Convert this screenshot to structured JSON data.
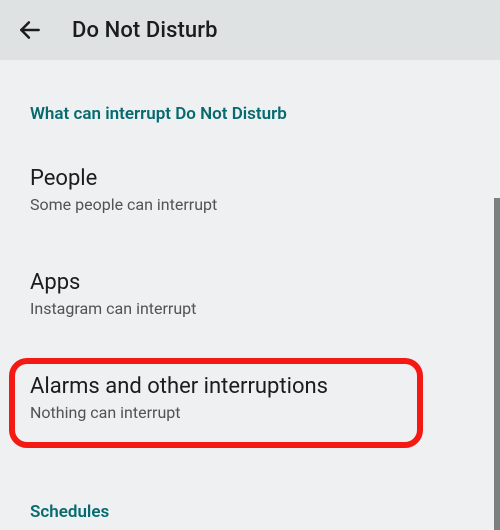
{
  "header": {
    "title": "Do Not Disturb"
  },
  "section1": {
    "label": "What can interrupt Do Not Disturb",
    "items": [
      {
        "title": "People",
        "subtitle": "Some people can interrupt"
      },
      {
        "title": "Apps",
        "subtitle": "Instagram can interrupt"
      },
      {
        "title": "Alarms and other interruptions",
        "subtitle": "Nothing can interrupt"
      }
    ]
  },
  "section2": {
    "label": "Schedules"
  }
}
